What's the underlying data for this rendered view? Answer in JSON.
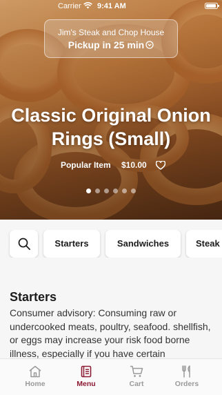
{
  "status_bar": {
    "carrier": "Carrier",
    "time": "9:41 AM"
  },
  "store": {
    "name": "Jim's Steak and Chop House",
    "pickup": "Pickup in 25 min"
  },
  "hero": {
    "title": "Classic Original Onion Rings (Small)",
    "badge": "Popular Item",
    "price": "$10.00",
    "carousel": {
      "count": 6,
      "active_index": 0
    }
  },
  "categories": [
    "Starters",
    "Sandwiches",
    "Steak"
  ],
  "section": {
    "title": "Starters",
    "advisory": "Consumer advisory: Consuming raw or undercooked meats, poultry, seafood. shellfish, or eggs may increase your risk food borne illness, especially if you have certain"
  },
  "tabs": [
    {
      "label": "Home",
      "icon": "home-icon",
      "active": false
    },
    {
      "label": "Menu",
      "icon": "menu-icon",
      "active": true
    },
    {
      "label": "Cart",
      "icon": "cart-icon",
      "active": false
    },
    {
      "label": "Orders",
      "icon": "orders-icon",
      "active": false
    }
  ],
  "colors": {
    "accent": "#8c1a33",
    "tab_inactive": "#9a9a9a",
    "background": "#f6f6f6"
  }
}
